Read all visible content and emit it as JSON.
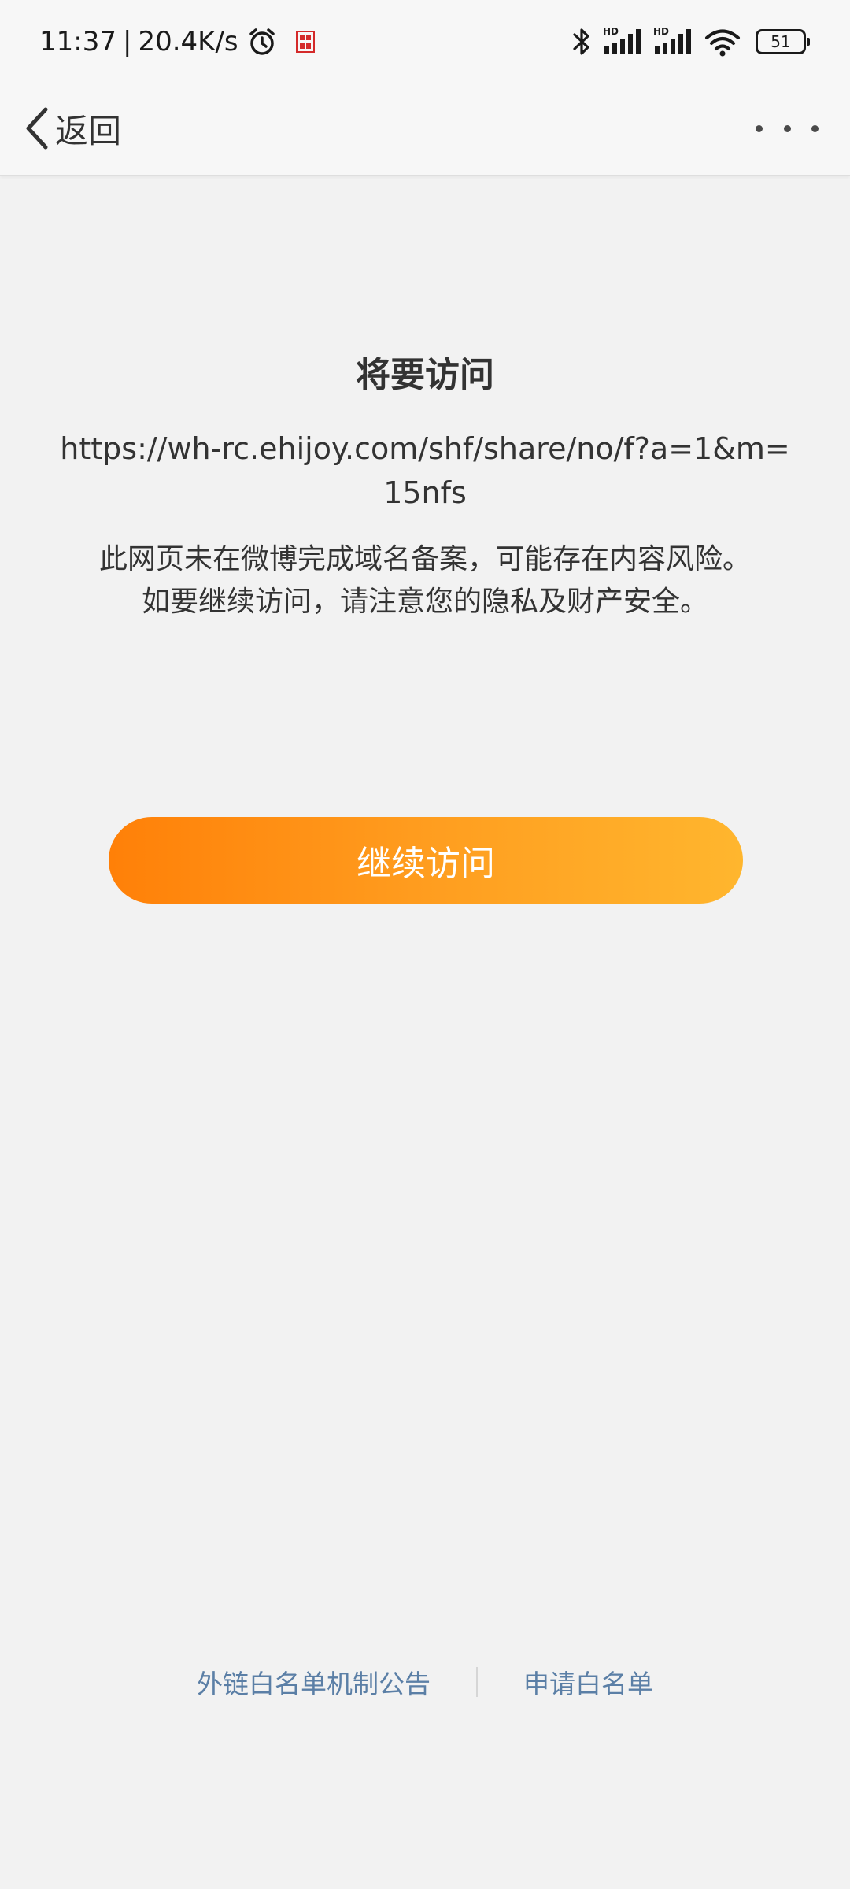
{
  "status_bar": {
    "time": "11:37",
    "separator": "|",
    "network_speed": "20.4K/s",
    "battery_level": "51",
    "icons": [
      "alarm-icon",
      "red-stamp-icon",
      "bluetooth-icon",
      "signal-hd-icon",
      "signal-hd-icon",
      "wifi-icon",
      "battery-icon"
    ],
    "signal_badge": "HD"
  },
  "nav_bar": {
    "back_label": "返回",
    "back_icon": "chevron-left-icon",
    "more_icon": "more-dots-icon"
  },
  "main": {
    "title": "将要访问",
    "url": "https://wh-rc.ehijoy.com/shf/share/no/f?a=1&m=15nfs",
    "warning_line1": "此网页未在微博完成域名备案，可能存在内容风险。",
    "warning_line2": "如要继续访问，请注意您的隐私及财产安全。",
    "continue_label": "继续访问"
  },
  "footer": {
    "link_whitelist_notice": "外链白名单机制公告",
    "link_apply_whitelist": "申请白名单"
  },
  "colors": {
    "background": "#f2f2f2",
    "button_gradient_start": "#ff8008",
    "button_gradient_end": "#ffb62e",
    "link": "#5b7fa6",
    "text": "#333333"
  }
}
